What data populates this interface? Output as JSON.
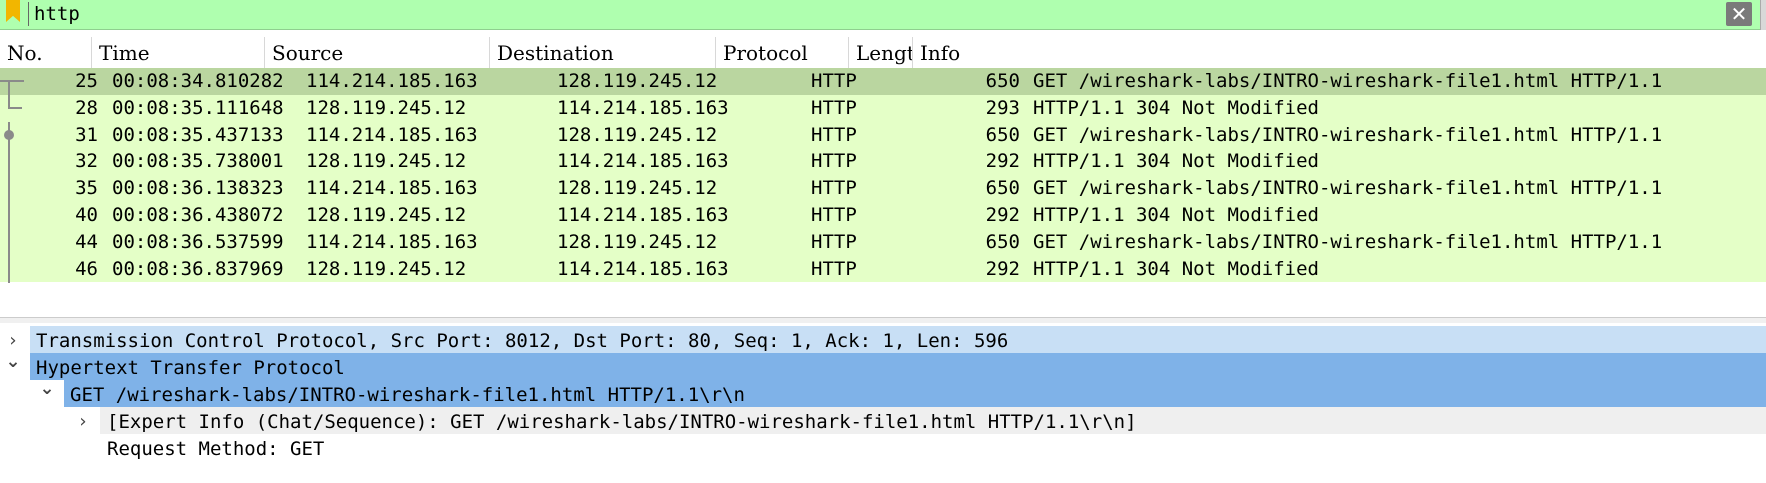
{
  "filter": {
    "value": "http",
    "clear_glyph": "✕"
  },
  "columns": [
    "No.",
    "Time",
    "Source",
    "Destination",
    "Protocol",
    "Lengt",
    "Info"
  ],
  "packets": [
    {
      "no": "25",
      "time": "00:08:34.810282",
      "src": "114.214.185.163",
      "dst": "128.119.245.12",
      "proto": "HTTP",
      "len": "650",
      "info": "GET /wireshark-labs/INTRO-wireshark-file1.html HTTP/1.1",
      "selected": true
    },
    {
      "no": "28",
      "time": "00:08:35.111648",
      "src": "128.119.245.12",
      "dst": "114.214.185.163",
      "proto": "HTTP",
      "len": "293",
      "info": "HTTP/1.1 304 Not Modified"
    },
    {
      "no": "31",
      "time": "00:08:35.437133",
      "src": "114.214.185.163",
      "dst": "128.119.245.12",
      "proto": "HTTP",
      "len": "650",
      "info": "GET /wireshark-labs/INTRO-wireshark-file1.html HTTP/1.1"
    },
    {
      "no": "32",
      "time": "00:08:35.738001",
      "src": "128.119.245.12",
      "dst": "114.214.185.163",
      "proto": "HTTP",
      "len": "292",
      "info": "HTTP/1.1 304 Not Modified"
    },
    {
      "no": "35",
      "time": "00:08:36.138323",
      "src": "114.214.185.163",
      "dst": "128.119.245.12",
      "proto": "HTTP",
      "len": "650",
      "info": "GET /wireshark-labs/INTRO-wireshark-file1.html HTTP/1.1"
    },
    {
      "no": "40",
      "time": "00:08:36.438072",
      "src": "128.119.245.12",
      "dst": "114.214.185.163",
      "proto": "HTTP",
      "len": "292",
      "info": "HTTP/1.1 304 Not Modified"
    },
    {
      "no": "44",
      "time": "00:08:36.537599",
      "src": "114.214.185.163",
      "dst": "128.119.245.12",
      "proto": "HTTP",
      "len": "650",
      "info": "GET /wireshark-labs/INTRO-wireshark-file1.html HTTP/1.1"
    },
    {
      "no": "46",
      "time": "00:08:36.837969",
      "src": "128.119.245.12",
      "dst": "114.214.185.163",
      "proto": "HTTP",
      "len": "292",
      "info": "HTTP/1.1 304 Not Modified"
    }
  ],
  "details": [
    {
      "text": "Transmission Control Protocol, Src Port: 8012, Dst Port: 80, Seq: 1, Ack: 1, Len: 596",
      "expanded": false,
      "level": 0,
      "bg": "#c8dff5"
    },
    {
      "text": "Hypertext Transfer Protocol",
      "expanded": true,
      "level": 0,
      "bg": "#7fb2e8"
    },
    {
      "text": "GET /wireshark-labs/INTRO-wireshark-file1.html HTTP/1.1\\r\\n",
      "expanded": true,
      "level": 1,
      "bg": "#7fb2e8"
    },
    {
      "text": "[Expert Info (Chat/Sequence): GET /wireshark-labs/INTRO-wireshark-file1.html HTTP/1.1\\r\\n]",
      "expanded": false,
      "level": 2,
      "bg": "#efefef"
    },
    {
      "text": "Request Method: GET",
      "expanded": null,
      "level": 2,
      "bg": "#ffffff"
    }
  ],
  "colors": {
    "filter_bg": "#afffaf",
    "row_bg": "#e4ffc7",
    "selected_row_bg": "#bad6a0",
    "tree_selected": "#7fb2e8"
  }
}
